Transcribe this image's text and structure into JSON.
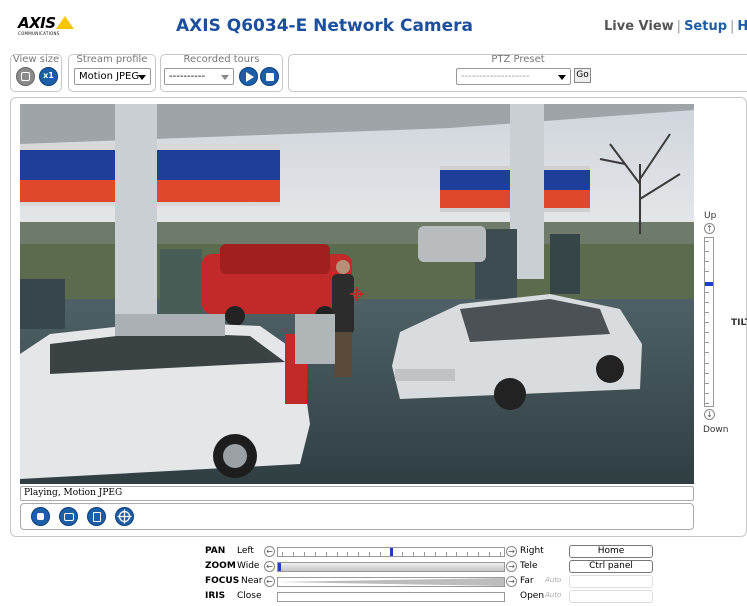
{
  "header": {
    "logo_text": "AXIS",
    "logo_sub": "COMMUNICATIONS",
    "title": "AXIS Q6034-E Network Camera",
    "nav": [
      {
        "label": "Live View"
      },
      {
        "label": "Setup"
      },
      {
        "label": "Help"
      }
    ],
    "separator": "|"
  },
  "toolbar": {
    "view_size_label": "View size",
    "view_size_x1": "x1",
    "stream_profile_label": "Stream profile",
    "stream_profile_value": "Motion JPEG",
    "recorded_tours_label": "Recorded tours",
    "recorded_tours_value": "----------",
    "ptz_preset_label": "PTZ Preset",
    "ptz_preset_value": "-------------------",
    "go_label": "Go"
  },
  "status": {
    "text": "Playing, Motion JPEG"
  },
  "tilt": {
    "up_label": "Up",
    "down_label": "Down",
    "label": "TILT",
    "position": 0.27
  },
  "ptz": {
    "pan": {
      "name": "PAN",
      "min": "Left",
      "max": "Right",
      "button": "Home",
      "position": 0.5
    },
    "zoom": {
      "name": "ZOOM",
      "min": "Wide",
      "max": "Tele",
      "button": "Ctrl panel",
      "position": 0.0
    },
    "focus": {
      "name": "FOCUS",
      "min": "Near",
      "max": "Far",
      "auto": "Auto"
    },
    "iris": {
      "name": "IRIS",
      "min": "Close",
      "max": "Open",
      "auto": "Auto"
    }
  },
  "colors": {
    "brand_blue": "#1c4f9c",
    "link_blue": "#1c5ea8",
    "slider_knob": "#1c3fc4",
    "logo_yellow": "#f7c600"
  }
}
